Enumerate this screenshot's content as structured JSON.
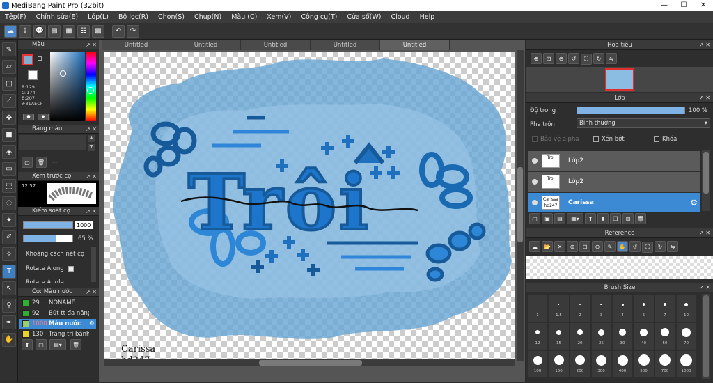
{
  "app": {
    "title": "MediBang Paint Pro (32bit)"
  },
  "window_buttons": {
    "minimize": "—",
    "maximize": "☐",
    "close": "✕"
  },
  "menu": [
    "Tệp(F)",
    "Chỉnh sửa(E)",
    "Lớp(L)",
    "Bộ lọc(R)",
    "Chọn(S)",
    "Chụp(N)",
    "Màu (C)",
    "Xem(V)",
    "Công cụ(T)",
    "Cửa sổ(W)",
    "Cloud",
    "Help"
  ],
  "tabs": [
    "Untitled",
    "Untitled",
    "Untitled",
    "Untitled",
    "Untitled"
  ],
  "color_panel": {
    "title": "Màu",
    "r": "R:129",
    "g": "G:174",
    "b": "B:207",
    "hex": "#81AECF",
    "fg": "#81AECF"
  },
  "palette_panel": {
    "title": "Bảng màu",
    "name": "---"
  },
  "preview_panel": {
    "title": "Xem trước cọ",
    "zoom": "72.57"
  },
  "brush_control": {
    "title": "Kiểm soát cọ",
    "size": "1000",
    "opacity": "65 %",
    "opacity_value": 0.65,
    "spacing_label": "Khoảng cách nét cọ",
    "rotate_along": "Rotate Along",
    "rotate_angle": "Rotate Angle"
  },
  "brush_list": {
    "title": "Cọ: Màu nước",
    "items": [
      {
        "size": "29",
        "name": "NONAME",
        "color": "#2fb12f"
      },
      {
        "size": "92",
        "name": "Bút tt đa năng",
        "color": "#2fb12f"
      },
      {
        "size": "1000",
        "name": "Màu nước",
        "color": "#9ad06a",
        "selected": true
      },
      {
        "size": "130",
        "name": "Trang trí bánh",
        "color": "#e8d22a"
      }
    ]
  },
  "navigator": {
    "title": "Hoa tiêu"
  },
  "layer_panel": {
    "title": "Lớp",
    "opacity_label": "Độ trong",
    "opacity": "100 %",
    "opacity_value": 1.0,
    "blend_label": "Pha trộn",
    "blend_mode": "Bình thường",
    "protect_alpha": "Bảo vệ alpha",
    "clipping": "Xén bớt",
    "lock": "Khóa",
    "layers": [
      {
        "name": "Lớp2",
        "thumb": "Troi"
      },
      {
        "name": "Lớp2",
        "thumb": "Troi"
      },
      {
        "name": "Carissa",
        "thumb": "Carissa hd247",
        "selected": true
      }
    ]
  },
  "reference_panel": {
    "title": "Reference"
  },
  "brush_size_panel": {
    "title": "Brush Size",
    "rows": [
      [
        "1",
        "1.5",
        "2",
        "3",
        "4",
        "5",
        "7",
        "10"
      ],
      [
        "12",
        "15",
        "20",
        "25",
        "30",
        "40",
        "50",
        "70"
      ],
      [
        "100",
        "150",
        "200",
        "300",
        "400",
        "500",
        "700",
        "1000"
      ]
    ]
  },
  "canvas_signature": {
    "line1": "Carissa",
    "line2": "hd247"
  },
  "artwork_text": "Trôi"
}
